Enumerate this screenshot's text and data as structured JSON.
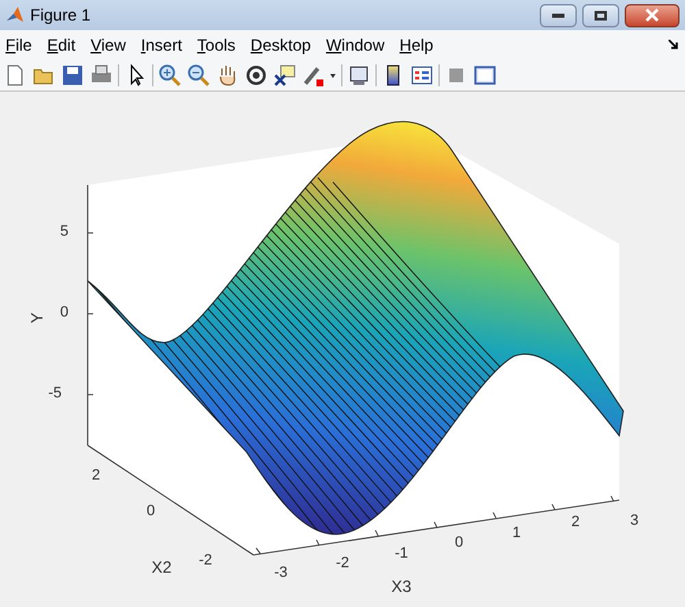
{
  "window": {
    "title": "Figure 1"
  },
  "menu": [
    "File",
    "Edit",
    "View",
    "Insert",
    "Tools",
    "Desktop",
    "Window",
    "Help"
  ],
  "plot": {
    "y_label": "Y",
    "x2_label": "X2",
    "x3_label": "X3",
    "y_ticks": [
      "5",
      "0",
      "-5"
    ],
    "x2_ticks": [
      "2",
      "0",
      "-2"
    ],
    "x3_ticks": [
      "-3",
      "-2",
      "-1",
      "0",
      "1",
      "2",
      "3"
    ]
  }
}
